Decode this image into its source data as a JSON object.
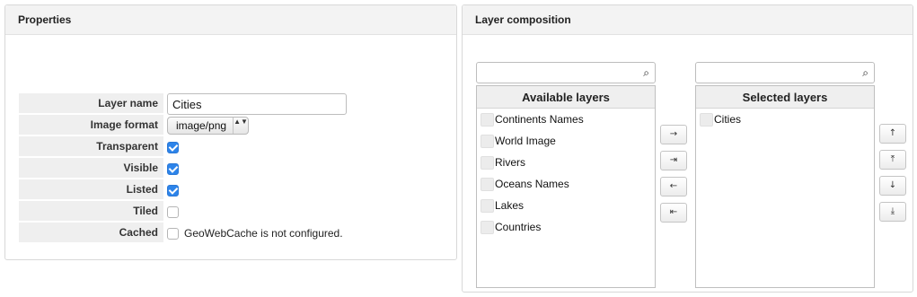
{
  "properties": {
    "title": "Properties",
    "fields": [
      {
        "label": "Layer name"
      },
      {
        "label": "Image format"
      },
      {
        "label": "Transparent"
      },
      {
        "label": "Visible"
      },
      {
        "label": "Listed"
      },
      {
        "label": "Tiled"
      },
      {
        "label": "Cached"
      }
    ],
    "layer_name_value": "Cities",
    "image_format_value": "image/png",
    "image_format_arrows": "▲▼",
    "transparent_checked": true,
    "visible_checked": true,
    "listed_checked": true,
    "tiled_checked": false,
    "cached_checked": false,
    "cached_note": "GeoWebCache is not configured.",
    "accent_color": "#2d84ea"
  },
  "composition": {
    "title": "Layer composition",
    "search_icon": "⌕",
    "available": {
      "title": "Available layers",
      "search_value": "",
      "items": [
        "Continents Names",
        "World Image",
        "Rivers",
        "Oceans Names",
        "Lakes",
        "Countries"
      ]
    },
    "selected": {
      "title": "Selected layers",
      "search_value": "",
      "items": [
        "Cities"
      ]
    },
    "transfer_buttons": {
      "add": "→",
      "add_all": "⇥",
      "remove": "←",
      "remove_all": "⇤"
    },
    "order_buttons": {
      "up": "↑",
      "top": "⤒",
      "down": "↓",
      "bottom": "⤓"
    }
  }
}
